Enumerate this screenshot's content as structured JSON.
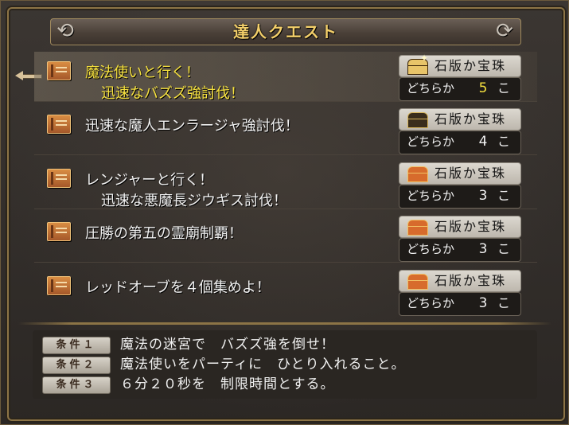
{
  "title": "達人クエスト",
  "ornaments": {
    "left": "⟲",
    "right": "⟳"
  },
  "quests": [
    {
      "line1": "魔法使いと行く！",
      "line2": "迅速なバズズ強討伐！",
      "reward_label": "石版か宝珠",
      "either_label": "どちらか",
      "count": "5",
      "unit": "こ",
      "chest": "gold-chest-icon",
      "selected": true
    },
    {
      "line1": "迅速な魔人エンラージャ強討伐！",
      "line2": "",
      "reward_label": "石版か宝珠",
      "either_label": "どちらか",
      "count": "4",
      "unit": "こ",
      "chest": "black-chest-icon",
      "selected": false
    },
    {
      "line1": "レンジャーと行く！",
      "line2": "迅速な悪魔長ジウギス討伐！",
      "reward_label": "石版か宝珠",
      "either_label": "どちらか",
      "count": "3",
      "unit": "こ",
      "chest": "red-chest-icon",
      "selected": false
    },
    {
      "line1": "圧勝の第五の霊廟制覇！",
      "line2": "",
      "reward_label": "石版か宝珠",
      "either_label": "どちらか",
      "count": "3",
      "unit": "こ",
      "chest": "red-chest-icon",
      "selected": false
    },
    {
      "line1": "レッドオーブを４個集めよ！",
      "line2": "",
      "reward_label": "石版か宝珠",
      "either_label": "どちらか",
      "count": "3",
      "unit": "こ",
      "chest": "red-chest-icon",
      "selected": false
    }
  ],
  "conditions": [
    {
      "badge": "条件１",
      "text": "魔法の迷宮で　バズズ強を倒せ！"
    },
    {
      "badge": "条件２",
      "text": "魔法使いをパーティに　ひとり入れること。"
    },
    {
      "badge": "条件３",
      "text": "６分２０秒を　制限時間とする。"
    }
  ],
  "colors": {
    "title": "#f3cf6a",
    "selected_text": "#f7e23f",
    "frame": "#8c7446"
  }
}
